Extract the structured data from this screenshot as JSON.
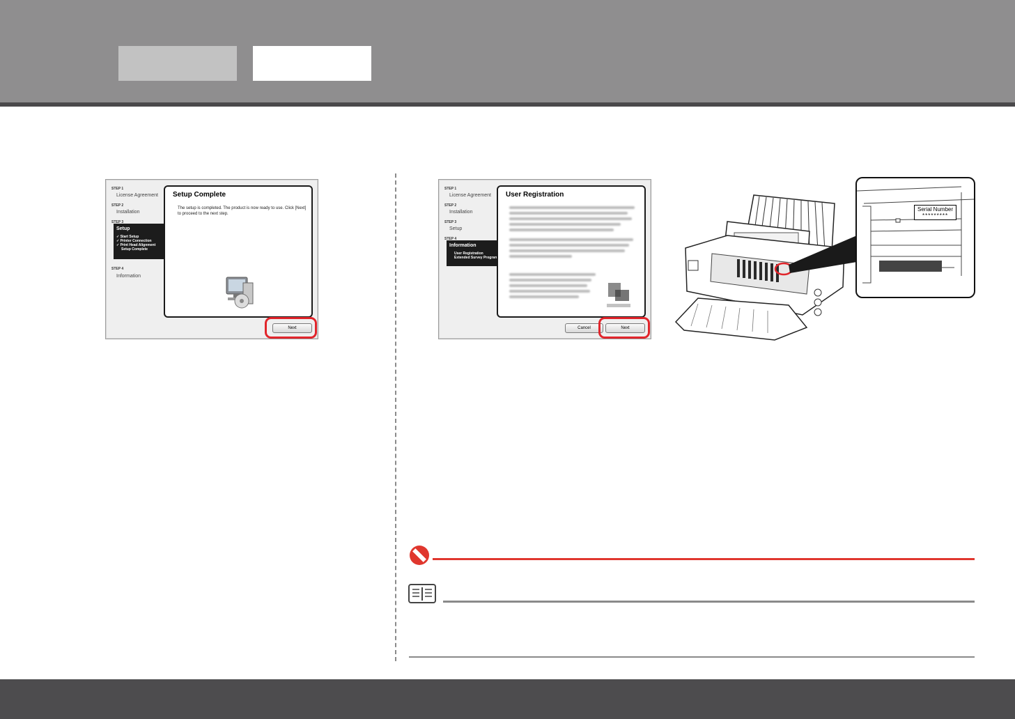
{
  "left_dialog": {
    "steps": [
      {
        "header": "STEP 1",
        "label": "License Agreement"
      },
      {
        "header": "STEP 2",
        "label": "Installation"
      },
      {
        "header": "STEP 3",
        "label": "Setup"
      },
      {
        "header": "STEP 4",
        "label": "Information"
      }
    ],
    "active_items": [
      "✓ Start Setup",
      "✓ Printer Connection",
      "✓ Print Head Alignment",
      "Setup Complete"
    ],
    "title": "Setup Complete",
    "body": "The setup is completed. The product is now ready to use. Click [Next] to proceed to the next step.",
    "next_label": "Next"
  },
  "right_dialog": {
    "steps": [
      {
        "header": "STEP 1",
        "label": "License Agreement"
      },
      {
        "header": "STEP 2",
        "label": "Installation"
      },
      {
        "header": "STEP 3",
        "label": "Setup"
      },
      {
        "header": "STEP 4",
        "label": "Information"
      }
    ],
    "active_items": [
      "User Registration",
      "Extended Survey Program"
    ],
    "title": "User Registration",
    "cancel_label": "Cancel",
    "next_label": "Next"
  },
  "printer_figure": {
    "callout_label": "Serial Number",
    "callout_mask": "*********"
  },
  "colors": {
    "header": "#8f8e8f",
    "header_rule": "#4a494b",
    "footer": "#4d4c4e",
    "highlight": "#e1252b",
    "caution": "#e0372e"
  },
  "icons": [
    "computer-setup-icon",
    "no-entry-icon",
    "book-note-icon"
  ]
}
